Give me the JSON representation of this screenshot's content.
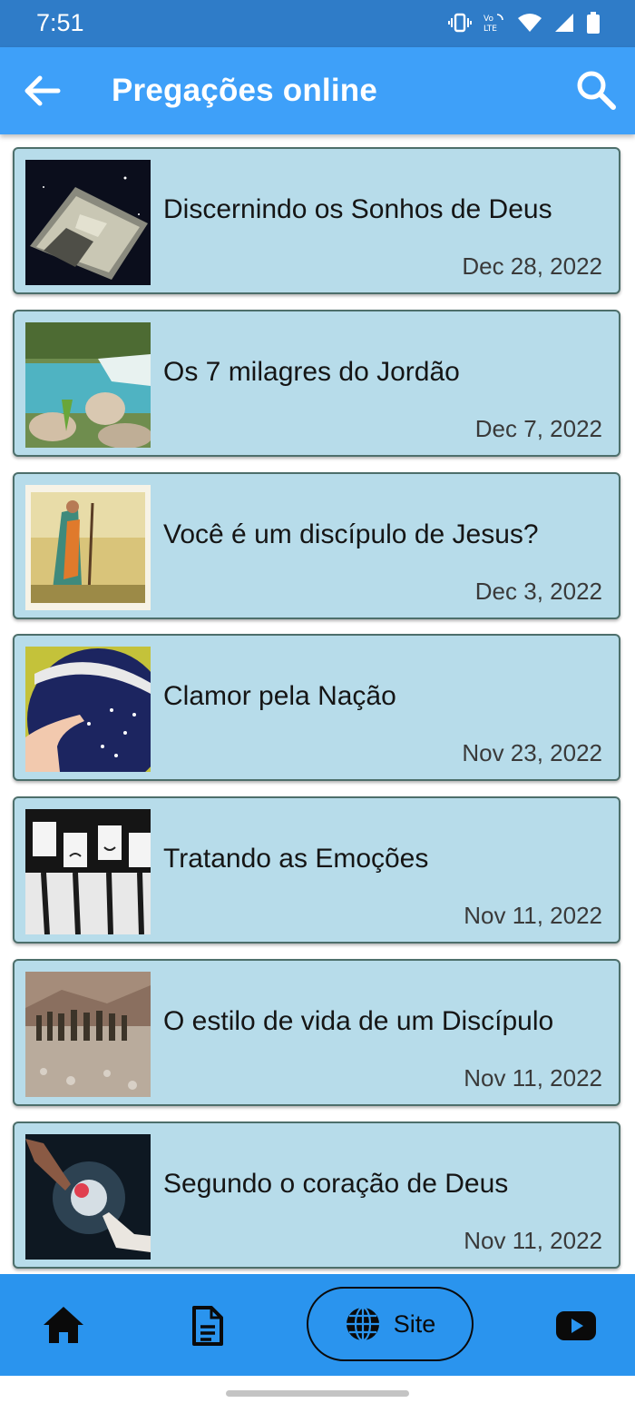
{
  "status_bar": {
    "time": "7:51"
  },
  "app_bar": {
    "title": "Pregações online"
  },
  "sermons": [
    {
      "title": "Discernindo os Sonhos de Deus",
      "date": "Dec 28, 2022",
      "thumbnail": "open-book-image"
    },
    {
      "title": "Os 7 milagres do Jordão",
      "date": "Dec 7, 2022",
      "thumbnail": "river-image"
    },
    {
      "title": "Você é um discípulo de Jesus?",
      "date": "Dec 3, 2022",
      "thumbnail": "disciple-painting-image"
    },
    {
      "title": "Clamor pela Nação",
      "date": "Nov 23, 2022",
      "thumbnail": "brazil-flag-image"
    },
    {
      "title": "Tratando as Emoções",
      "date": "Nov 11, 2022",
      "thumbnail": "emotion-faces-image"
    },
    {
      "title": "O estilo de vida de um Discípulo",
      "date": "Nov 11, 2022",
      "thumbnail": "desert-crowd-image"
    },
    {
      "title": "Segundo o coração de Deus",
      "date": "Nov 11, 2022",
      "thumbnail": "reaching-hands-image"
    }
  ],
  "bottom_nav": {
    "items": [
      {
        "icon": "home-icon"
      },
      {
        "icon": "document-icon"
      },
      {
        "icon": "globe-icon",
        "label": "Site"
      },
      {
        "icon": "youtube-icon"
      }
    ]
  },
  "colors": {
    "status_bar": "#2f7cc8",
    "app_bar": "#3ea0f9",
    "card_background": "#b7dcea",
    "card_border": "#4d6f6b",
    "bottom_nav": "#2a94ee"
  }
}
